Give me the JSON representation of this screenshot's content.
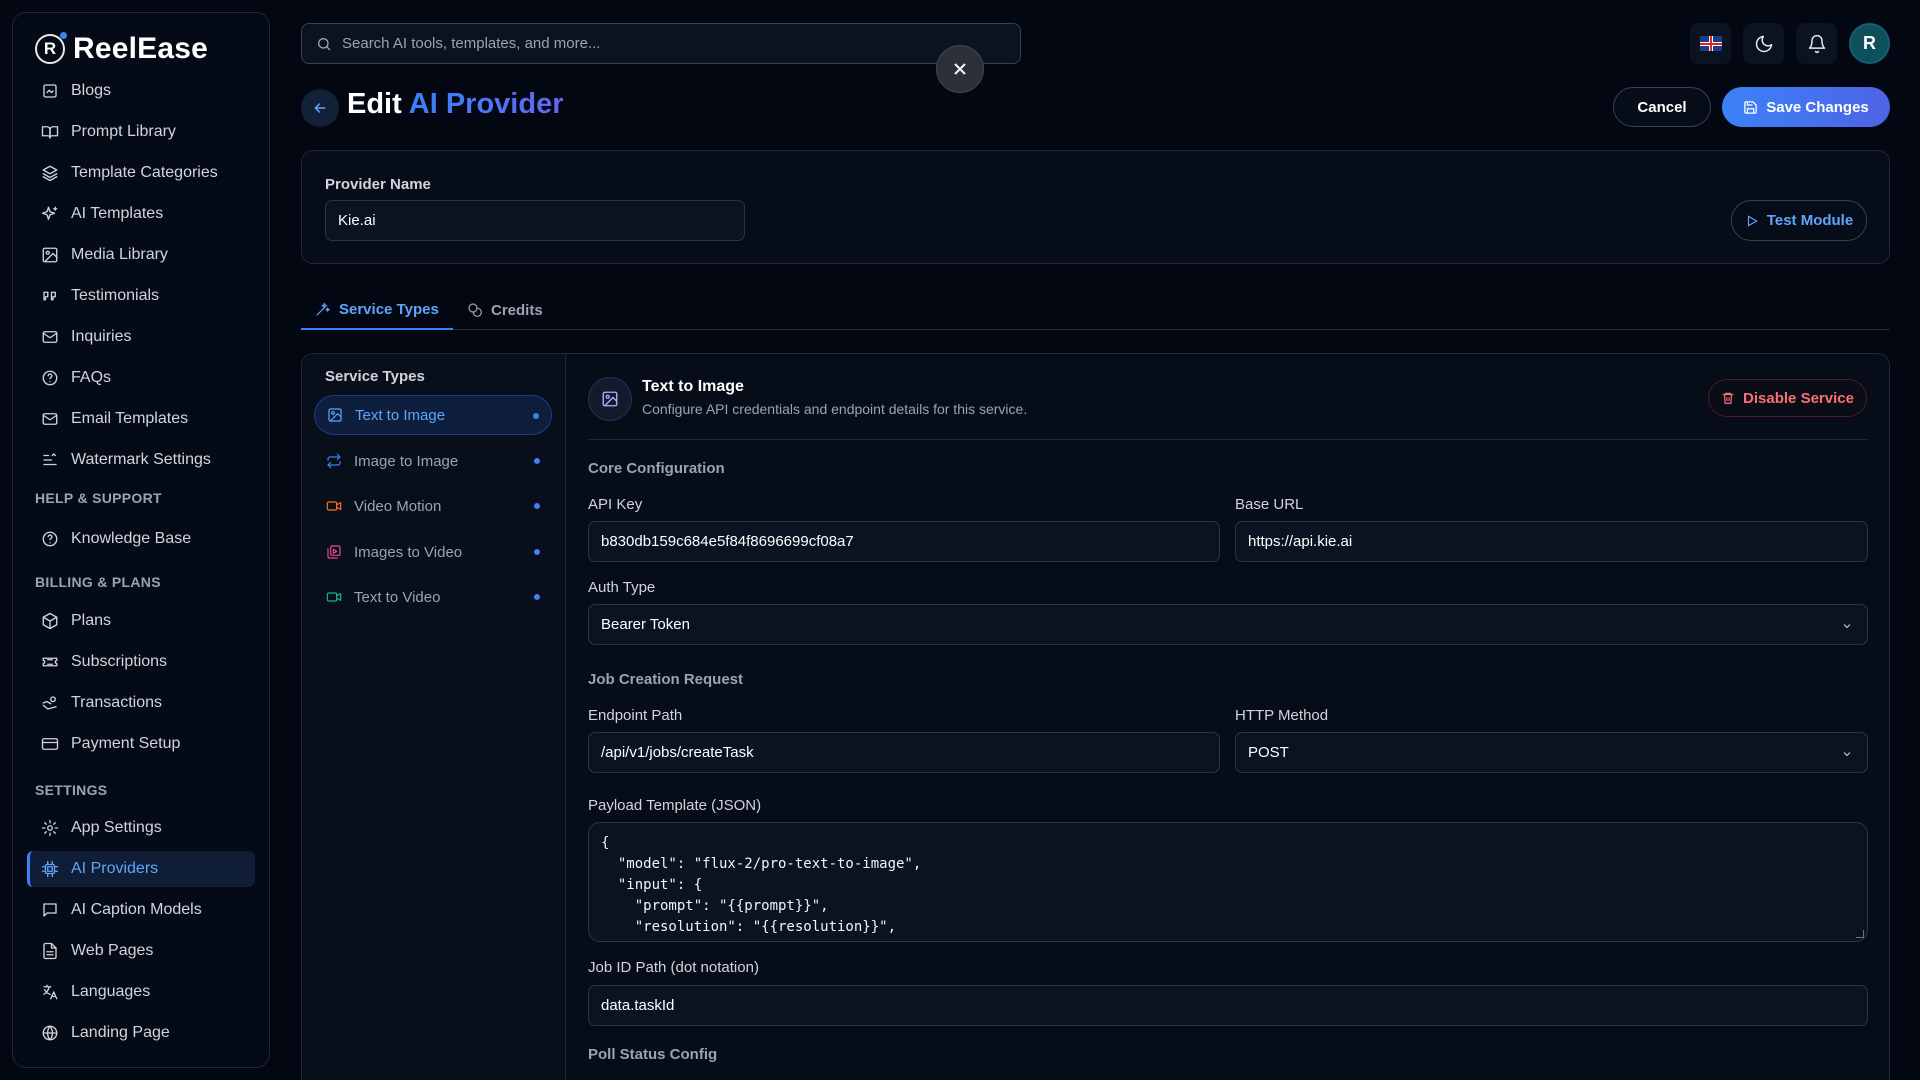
{
  "brand": {
    "name": "ReelEase",
    "mark": "R"
  },
  "sidebar": {
    "items": [
      {
        "label": "Blogs",
        "icon": "blog-icon"
      },
      {
        "label": "Prompt Library",
        "icon": "book-open-icon"
      },
      {
        "label": "Template Categories",
        "icon": "layers-icon"
      },
      {
        "label": "AI Templates",
        "icon": "sparkles-icon"
      },
      {
        "label": "Media Library",
        "icon": "image-icon"
      },
      {
        "label": "Testimonials",
        "icon": "quote-icon"
      },
      {
        "label": "Inquiries",
        "icon": "mail-icon"
      },
      {
        "label": "FAQs",
        "icon": "help-circle-icon"
      },
      {
        "label": "Email Templates",
        "icon": "mail-icon"
      },
      {
        "label": "Watermark Settings",
        "icon": "watermark-icon"
      }
    ],
    "sections": {
      "help": "HELP & SUPPORT",
      "billing": "BILLING & PLANS",
      "settings": "SETTINGS"
    },
    "help_items": [
      {
        "label": "Knowledge Base",
        "icon": "help-circle-icon"
      }
    ],
    "billing_items": [
      {
        "label": "Plans",
        "icon": "package-icon"
      },
      {
        "label": "Subscriptions",
        "icon": "ticket-icon"
      },
      {
        "label": "Transactions",
        "icon": "hand-coins-icon"
      },
      {
        "label": "Payment Setup",
        "icon": "credit-card-icon"
      }
    ],
    "settings_items": [
      {
        "label": "App Settings",
        "icon": "gear-icon"
      },
      {
        "label": "AI Providers",
        "icon": "cpu-icon",
        "active": true
      },
      {
        "label": "AI Caption Models",
        "icon": "message-square-icon"
      },
      {
        "label": "Web Pages",
        "icon": "file-text-icon"
      },
      {
        "label": "Languages",
        "icon": "languages-icon"
      },
      {
        "label": "Landing Page",
        "icon": "globe-icon"
      }
    ]
  },
  "search": {
    "placeholder": "Search AI tools, templates, and more..."
  },
  "header": {
    "title_prefix": "Edit",
    "title_accent": "AI Provider",
    "cancel_label": "Cancel",
    "save_label": "Save Changes",
    "avatar_initial": "R"
  },
  "provider": {
    "name_label": "Provider Name",
    "name_value": "Kie.ai",
    "test_label": "Test Module"
  },
  "tabs": [
    {
      "label": "Service Types",
      "active": true
    },
    {
      "label": "Credits",
      "active": false
    }
  ],
  "services": {
    "title": "Service Types",
    "items": [
      {
        "label": "Text to Image",
        "active": true,
        "color": "#60a5fa"
      },
      {
        "label": "Image to Image",
        "active": false,
        "color": "#3b82f6"
      },
      {
        "label": "Video Motion",
        "active": false,
        "color": "#f97316"
      },
      {
        "label": "Images to Video",
        "active": false,
        "color": "#ec4899"
      },
      {
        "label": "Text to Video",
        "active": false,
        "color": "#10b981"
      }
    ]
  },
  "detail": {
    "title": "Text to Image",
    "subtitle": "Configure API credentials and endpoint details for this service.",
    "disable_label": "Disable Service",
    "core_section": "Core Configuration",
    "api_key_label": "API Key",
    "api_key_value": "b830db159c684e5f84f8696699cf08a7",
    "base_url_label": "Base URL",
    "base_url_value": "https://api.kie.ai",
    "auth_type_label": "Auth Type",
    "auth_type_value": "Bearer Token",
    "job_section": "Job Creation Request",
    "endpoint_label": "Endpoint Path",
    "endpoint_value": "/api/v1/jobs/createTask",
    "method_label": "HTTP Method",
    "method_value": "POST",
    "payload_label": "Payload Template (JSON)",
    "payload_value": "{\n  \"model\": \"flux-2/pro-text-to-image\",\n  \"input\": {\n    \"prompt\": \"{{prompt}}\",\n    \"resolution\": \"{{resolution}}\",\n    \"aspect_ratio\": \"{{aspect_ratio}}\"",
    "job_id_label": "Job ID Path (dot notation)",
    "job_id_value": "data.taskId",
    "poll_section": "Poll Status Config"
  }
}
